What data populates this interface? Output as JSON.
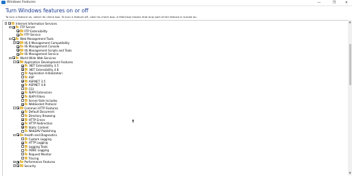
{
  "window": {
    "title": "Windows Features",
    "minimize": "—",
    "restore": "❐",
    "close": "✕"
  },
  "heading": "Turn Windows features on or off",
  "subtext": "To turn a feature on, select its check box. To turn a feature off, clear its check box. A filled box means that only part of the feature is turned on.",
  "features": [
    {
      "level": 0,
      "exp": "-",
      "state": "partial",
      "folder": true,
      "label": "Internet Information Services"
    },
    {
      "level": 1,
      "exp": "-",
      "state": "partial",
      "folder": true,
      "label": "FTP Server"
    },
    {
      "level": 2,
      "exp": "",
      "state": "checked",
      "folder": true,
      "label": "FTP Extensibility"
    },
    {
      "level": 2,
      "exp": "",
      "state": "checked",
      "folder": true,
      "label": "FTP Service"
    },
    {
      "level": 1,
      "exp": "-",
      "state": "checked",
      "folder": true,
      "label": "Web Management Tools"
    },
    {
      "level": 2,
      "exp": "+",
      "state": "checked",
      "folder": true,
      "label": "IIS 6 Management Compatibility"
    },
    {
      "level": 2,
      "exp": "",
      "state": "checked",
      "folder": true,
      "label": "IIS Management Console"
    },
    {
      "level": 2,
      "exp": "",
      "state": "checked",
      "folder": true,
      "label": "IIS Management Scripts and Tools"
    },
    {
      "level": 2,
      "exp": "",
      "state": "checked",
      "folder": true,
      "label": "IIS Management Service"
    },
    {
      "level": 1,
      "exp": "-",
      "state": "partial",
      "folder": true,
      "label": "World Wide Web Services"
    },
    {
      "level": 2,
      "exp": "-",
      "state": "partial",
      "folder": true,
      "label": "Application Development Features"
    },
    {
      "level": 3,
      "exp": "",
      "state": "checked",
      "folder": true,
      "label": ".NET Extensibility 3.5"
    },
    {
      "level": 3,
      "exp": "",
      "state": "checked",
      "folder": true,
      "label": ".NET Extensibility 4.8"
    },
    {
      "level": 3,
      "exp": "",
      "state": "none",
      "folder": true,
      "label": "Application Initialization"
    },
    {
      "level": 3,
      "exp": "",
      "state": "none",
      "folder": true,
      "label": "ASP"
    },
    {
      "level": 3,
      "exp": "",
      "state": "checked",
      "folder": true,
      "label": "ASP.NET 3.5"
    },
    {
      "level": 3,
      "exp": "",
      "state": "checked",
      "folder": true,
      "label": "ASP.NET 4.8"
    },
    {
      "level": 3,
      "exp": "",
      "state": "none",
      "folder": true,
      "label": "CGI"
    },
    {
      "level": 3,
      "exp": "",
      "state": "checked",
      "folder": true,
      "label": "ISAPI Extensions"
    },
    {
      "level": 3,
      "exp": "",
      "state": "checked",
      "folder": true,
      "label": "ISAPI Filters"
    },
    {
      "level": 3,
      "exp": "",
      "state": "none",
      "folder": true,
      "label": "Server-Side Includes"
    },
    {
      "level": 3,
      "exp": "",
      "state": "checked",
      "folder": true,
      "label": "WebSocket Protocol"
    },
    {
      "level": 2,
      "exp": "-",
      "state": "partial",
      "folder": true,
      "label": "Common HTTP Features"
    },
    {
      "level": 3,
      "exp": "",
      "state": "checked",
      "folder": true,
      "label": "Default Document"
    },
    {
      "level": 3,
      "exp": "",
      "state": "none",
      "folder": true,
      "label": "Directory Browsing"
    },
    {
      "level": 3,
      "exp": "",
      "state": "checked",
      "folder": true,
      "label": "HTTP Errors"
    },
    {
      "level": 3,
      "exp": "",
      "state": "checked",
      "folder": true,
      "label": "HTTP Redirection"
    },
    {
      "level": 3,
      "exp": "",
      "state": "checked",
      "folder": true,
      "label": "Static Content"
    },
    {
      "level": 3,
      "exp": "",
      "state": "none",
      "folder": true,
      "label": "WebDAV Publishing"
    },
    {
      "level": 2,
      "exp": "-",
      "state": "partial",
      "folder": true,
      "label": "Health and Diagnostics"
    },
    {
      "level": 3,
      "exp": "",
      "state": "none",
      "folder": true,
      "label": "Custom Logging"
    },
    {
      "level": 3,
      "exp": "",
      "state": "checked",
      "folder": true,
      "label": "HTTP Logging"
    },
    {
      "level": 3,
      "exp": "",
      "state": "none",
      "folder": true,
      "label": "Logging Tools"
    },
    {
      "level": 3,
      "exp": "",
      "state": "none",
      "folder": true,
      "label": "ODBC Logging"
    },
    {
      "level": 3,
      "exp": "",
      "state": "none",
      "folder": true,
      "label": "Request Monitor"
    },
    {
      "level": 3,
      "exp": "",
      "state": "none",
      "folder": true,
      "label": "Tracing"
    },
    {
      "level": 2,
      "exp": "+",
      "state": "partial",
      "folder": true,
      "label": "Performance Features"
    },
    {
      "level": 2,
      "exp": "+",
      "state": "partial",
      "folder": true,
      "label": "Security"
    }
  ]
}
